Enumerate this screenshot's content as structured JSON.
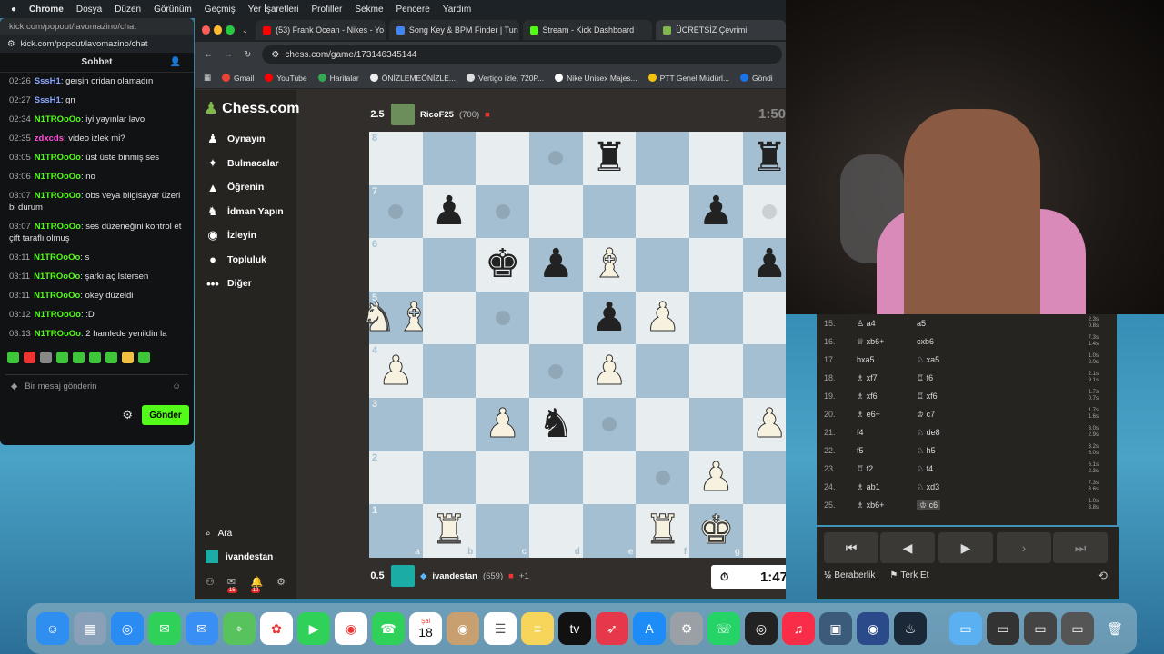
{
  "menubar": {
    "apple": "",
    "app": "Chrome",
    "items": [
      "Dosya",
      "Düzen",
      "Görünüm",
      "Geçmiş",
      "Yer İşaretleri",
      "Profiller",
      "Sekme",
      "Pencere",
      "Yardım"
    ]
  },
  "chat": {
    "url_top": "kick.com/popout/lavomazino/chat",
    "url": "kick.com/popout/lavomazino/chat",
    "title": "Sohbet",
    "messages": [
      {
        "time": "02:26",
        "user": "SssH1",
        "color": "#8aa6ff",
        "text": "geışin oridan olamadın"
      },
      {
        "time": "02:27",
        "user": "SssH1",
        "color": "#8aa6ff",
        "text": "gn"
      },
      {
        "time": "02:34",
        "user": "N1TROoOo",
        "color": "#53fc18",
        "text": "iyi yayınlar lavo"
      },
      {
        "time": "02:35",
        "user": "zdxcds",
        "color": "#ff4fd8",
        "text": "video izlek mi?"
      },
      {
        "time": "03:05",
        "user": "N1TROoOo",
        "color": "#53fc18",
        "text": "üst üste binmiş ses"
      },
      {
        "time": "03:06",
        "user": "N1TROoOo",
        "color": "#53fc18",
        "text": "no"
      },
      {
        "time": "03:07",
        "user": "N1TROoOo",
        "color": "#53fc18",
        "text": "obs veya bilgisayar üzeri bi durum"
      },
      {
        "time": "03:07",
        "user": "N1TROoOo",
        "color": "#53fc18",
        "text": "ses düzeneğini kontrol et çift taraflı olmuş"
      },
      {
        "time": "03:11",
        "user": "N1TROoOo",
        "color": "#53fc18",
        "text": "s"
      },
      {
        "time": "03:11",
        "user": "N1TROoOo",
        "color": "#53fc18",
        "text": "şarkı aç İstersen"
      },
      {
        "time": "03:11",
        "user": "N1TROoOo",
        "color": "#53fc18",
        "text": "okey düzeldi"
      },
      {
        "time": "03:12",
        "user": "N1TROoOo",
        "color": "#53fc18",
        "text": ":D"
      },
      {
        "time": "03:13",
        "user": "N1TROoOo",
        "color": "#53fc18",
        "text": "2 hamlede yenildin la"
      }
    ],
    "input_placeholder": "Bir mesaj gönderin",
    "send_label": "Gönder"
  },
  "tabs": [
    {
      "label": "(53) Frank Ocean - Nikes - Yo",
      "color": "#ff0000"
    },
    {
      "label": "Song Key & BPM Finder | Tun",
      "color": "#4285f4"
    },
    {
      "label": "Stream - Kick Dashboard",
      "color": "#53fc18"
    },
    {
      "label": "ÜCRETSİZ Çevrimi",
      "color": "#81b64c"
    }
  ],
  "address": "chess.com/game/173146345144",
  "bookmarks": [
    {
      "label": "Gmail",
      "color": "#ea4335"
    },
    {
      "label": "YouTube",
      "color": "#ff0000"
    },
    {
      "label": "Haritalar",
      "color": "#34a853"
    },
    {
      "label": "ÖNİZLEMEÖNİZLE...",
      "color": "#eee"
    },
    {
      "label": "Vertigo izle, 720P...",
      "color": "#ddd"
    },
    {
      "label": "Nike Unisex Majes...",
      "color": "#fff"
    },
    {
      "label": "PTT Genel Müdürl...",
      "color": "#f4c20d"
    },
    {
      "label": "Göndi",
      "color": "#1a73e8"
    }
  ],
  "site": {
    "logo": "Chess.com",
    "nav": [
      {
        "label": "Oynayın",
        "icon": "♟"
      },
      {
        "label": "Bulmacalar",
        "icon": "✦"
      },
      {
        "label": "Öğrenin",
        "icon": "▲"
      },
      {
        "label": "İdman Yapın",
        "icon": "♞"
      },
      {
        "label": "İzleyin",
        "icon": "◉"
      },
      {
        "label": "Topluluk",
        "icon": "●"
      },
      {
        "label": "Diğer",
        "icon": "•••"
      }
    ],
    "search": "Ara",
    "user": "ivandestan",
    "badge_mail": "15",
    "badge_bell": "12"
  },
  "top_player": {
    "score": "2.5",
    "name": "RicoF25",
    "rating": "(700)",
    "clock": "1:50"
  },
  "bottom_player": {
    "score": "0.5",
    "name": "ivandestan",
    "rating": "(659)",
    "extra": "+1",
    "clock": "1:47"
  },
  "board": [
    [
      "",
      "",
      "",
      "h",
      "r",
      "",
      "",
      "r"
    ],
    [
      "h",
      "p",
      "h",
      "",
      "",
      "",
      "p",
      "h"
    ],
    [
      "",
      "",
      "k",
      "p",
      "B",
      "",
      "",
      "p"
    ],
    [
      "N|B",
      "",
      "h",
      "",
      "p",
      "P",
      "",
      ""
    ],
    [
      "P",
      "",
      "",
      "h",
      "P",
      "",
      "",
      ""
    ],
    [
      "",
      "",
      "P",
      "n",
      "h",
      "",
      "",
      "P"
    ],
    [
      "",
      "",
      "",
      "",
      "",
      "h",
      "P",
      ""
    ],
    [
      "",
      "R",
      "",
      "",
      "",
      "R",
      "K",
      ""
    ]
  ],
  "files": [
    "a",
    "b",
    "c",
    "d",
    "e",
    "f",
    "g",
    "h"
  ],
  "ranks": [
    "8",
    "7",
    "6",
    "5",
    "4",
    "3",
    "2",
    "1"
  ],
  "moves": [
    {
      "n": "15.",
      "w": "♙ a4",
      "b": "a5",
      "t1": "2.3s",
      "t2": "0.8s"
    },
    {
      "n": "16.",
      "w": "♕ xb6+",
      "b": "cxb6",
      "t1": "7.3s",
      "t2": "1.4s"
    },
    {
      "n": "17.",
      "w": "bxa5",
      "b": "♘ xa5",
      "t1": "1.0s",
      "t2": "2.0s"
    },
    {
      "n": "18.",
      "w": "♗ xf7",
      "b": "♖ f6",
      "t1": "2.1s",
      "t2": "9.1s"
    },
    {
      "n": "19.",
      "w": "♗ xf6",
      "b": "♖ xf6",
      "t1": "1.7s",
      "t2": "0.7s"
    },
    {
      "n": "20.",
      "w": "♗ e6+",
      "b": "♔ c7",
      "t1": "1.7s",
      "t2": "1.6s"
    },
    {
      "n": "21.",
      "w": "f4",
      "b": "♘ de8",
      "t1": "3.0s",
      "t2": "2.9s"
    },
    {
      "n": "22.",
      "w": "f5",
      "b": "♘ h5",
      "t1": "3.2s",
      "t2": "6.0s"
    },
    {
      "n": "23.",
      "w": "♖ f2",
      "b": "♘ f4",
      "t1": "6.1s",
      "t2": "2.3s"
    },
    {
      "n": "24.",
      "w": "♗ ab1",
      "b": "♘ xd3",
      "t1": "7.3s",
      "t2": "3.6s"
    },
    {
      "n": "25.",
      "w": "♗ xb6+",
      "b": "♔ c6",
      "t1": "1.0s",
      "t2": "3.8s"
    }
  ],
  "controls": {
    "draw": "Beraberlik",
    "resign": "Terk Et",
    "half": "½"
  },
  "dock": {
    "date": "18",
    "day": "Şal"
  }
}
